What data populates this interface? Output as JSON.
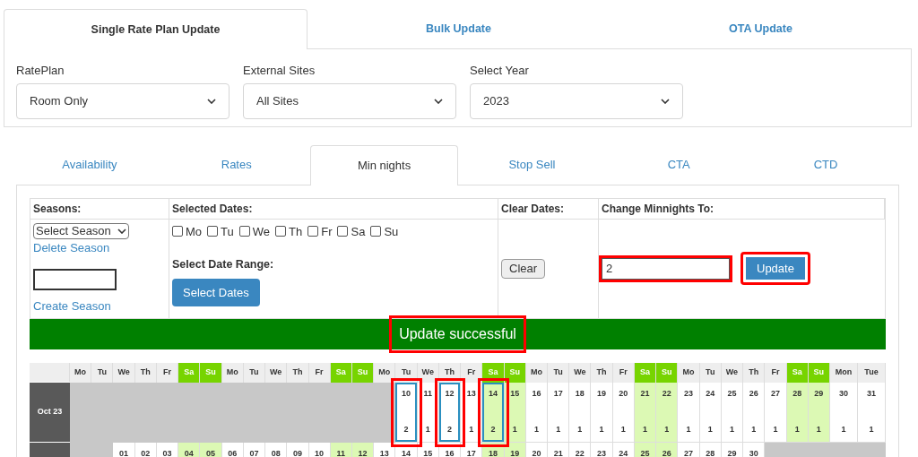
{
  "top_tabs": [
    {
      "label": "Single Rate Plan Update",
      "selected": true
    },
    {
      "label": "Bulk Update",
      "selected": false
    },
    {
      "label": "OTA Update",
      "selected": false
    }
  ],
  "filters": [
    {
      "label": "RatePlan",
      "value": "Room Only"
    },
    {
      "label": "External Sites",
      "value": "All Sites"
    },
    {
      "label": "Select Year",
      "value": "2023"
    }
  ],
  "sub_tabs": [
    {
      "label": "Availability",
      "selected": false
    },
    {
      "label": "Rates",
      "selected": false
    },
    {
      "label": "Min nights",
      "selected": true
    },
    {
      "label": "Stop Sell",
      "selected": false
    },
    {
      "label": "CTA",
      "selected": false
    },
    {
      "label": "CTD",
      "selected": false
    }
  ],
  "form": {
    "headers": [
      "Seasons:",
      "Selected Dates:",
      "Clear Dates:",
      "Change Minnights To:"
    ],
    "season_select": "Select Season",
    "delete_season": "Delete Season",
    "create_season": "Create Season",
    "weekdays": [
      {
        "label": "Mo",
        "checked": false
      },
      {
        "label": "Tu",
        "checked": false
      },
      {
        "label": "We",
        "checked": false
      },
      {
        "label": "Th",
        "checked": false
      },
      {
        "label": "Fr",
        "checked": false
      },
      {
        "label": "Sa",
        "checked": false
      },
      {
        "label": "Su",
        "checked": false
      }
    ],
    "date_range_label": "Select Date Range:",
    "select_dates_button": "Select Dates",
    "clear_button": "Clear",
    "minnights_value": "2",
    "minnights_annotated": true,
    "update_button": "Update",
    "update_annotated": true
  },
  "message": {
    "text": "Update successful",
    "annotated": true
  },
  "calendar": {
    "header": [
      {
        "label": "Mo",
        "weekend": false
      },
      {
        "label": "Tu",
        "weekend": false
      },
      {
        "label": "We",
        "weekend": false
      },
      {
        "label": "Th",
        "weekend": false
      },
      {
        "label": "Fr",
        "weekend": false
      },
      {
        "label": "Sa",
        "weekend": true
      },
      {
        "label": "Su",
        "weekend": true
      },
      {
        "label": "Mo",
        "weekend": false
      },
      {
        "label": "Tu",
        "weekend": false
      },
      {
        "label": "We",
        "weekend": false
      },
      {
        "label": "Th",
        "weekend": false
      },
      {
        "label": "Fr",
        "weekend": false
      },
      {
        "label": "Sa",
        "weekend": true
      },
      {
        "label": "Su",
        "weekend": true
      },
      {
        "label": "Mo",
        "weekend": false
      },
      {
        "label": "Tu",
        "weekend": false
      },
      {
        "label": "We",
        "weekend": false
      },
      {
        "label": "Th",
        "weekend": false
      },
      {
        "label": "Fr",
        "weekend": false
      },
      {
        "label": "Sa",
        "weekend": true
      },
      {
        "label": "Su",
        "weekend": true
      },
      {
        "label": "Mo",
        "weekend": false
      },
      {
        "label": "Tu",
        "weekend": false
      },
      {
        "label": "We",
        "weekend": false
      },
      {
        "label": "Th",
        "weekend": false
      },
      {
        "label": "Fr",
        "weekend": false
      },
      {
        "label": "Sa",
        "weekend": true
      },
      {
        "label": "Su",
        "weekend": true
      },
      {
        "label": "Mo",
        "weekend": false
      },
      {
        "label": "Tu",
        "weekend": false
      },
      {
        "label": "We",
        "weekend": false
      },
      {
        "label": "Th",
        "weekend": false
      },
      {
        "label": "Fr",
        "weekend": false
      },
      {
        "label": "Sa",
        "weekend": true
      },
      {
        "label": "Su",
        "weekend": true
      },
      {
        "label": "Mon",
        "weekend": false
      },
      {
        "label": "Tue",
        "weekend": false
      }
    ],
    "months": [
      {
        "label": "Oct 23",
        "cells": [
          {
            "kind": "blank"
          },
          {
            "kind": "blank"
          },
          {
            "kind": "blank"
          },
          {
            "kind": "blank"
          },
          {
            "kind": "blank"
          },
          {
            "kind": "blank"
          },
          {
            "kind": "blank"
          },
          {
            "kind": "blank"
          },
          {
            "kind": "blank"
          },
          {
            "kind": "blank"
          },
          {
            "kind": "blank"
          },
          {
            "kind": "blank"
          },
          {
            "kind": "blank"
          },
          {
            "kind": "blank"
          },
          {
            "kind": "blank"
          },
          {
            "kind": "day",
            "day": "10",
            "value": "2",
            "selected": true,
            "annotated": true
          },
          {
            "kind": "day",
            "day": "11",
            "value": "1",
            "selected": false,
            "annotated": false
          },
          {
            "kind": "day",
            "day": "12",
            "value": "2",
            "selected": true,
            "annotated": true
          },
          {
            "kind": "day",
            "day": "13",
            "value": "1",
            "selected": false,
            "annotated": false
          },
          {
            "kind": "day",
            "day": "14",
            "value": "2",
            "selected": true,
            "annotated": true
          },
          {
            "kind": "day",
            "day": "15",
            "value": "1",
            "selected": false,
            "annotated": false
          },
          {
            "kind": "day",
            "day": "16",
            "value": "1",
            "selected": false,
            "annotated": false
          },
          {
            "kind": "day",
            "day": "17",
            "value": "1",
            "selected": false,
            "annotated": false
          },
          {
            "kind": "day",
            "day": "18",
            "value": "1",
            "selected": false,
            "annotated": false
          },
          {
            "kind": "day",
            "day": "19",
            "value": "1",
            "selected": false,
            "annotated": false
          },
          {
            "kind": "day",
            "day": "20",
            "value": "1",
            "selected": false,
            "annotated": false
          },
          {
            "kind": "day",
            "day": "21",
            "value": "1",
            "selected": false,
            "annotated": false
          },
          {
            "kind": "day",
            "day": "22",
            "value": "1",
            "selected": false,
            "annotated": false
          },
          {
            "kind": "day",
            "day": "23",
            "value": "1",
            "selected": false,
            "annotated": false
          },
          {
            "kind": "day",
            "day": "24",
            "value": "1",
            "selected": false,
            "annotated": false
          },
          {
            "kind": "day",
            "day": "25",
            "value": "1",
            "selected": false,
            "annotated": false
          },
          {
            "kind": "day",
            "day": "26",
            "value": "1",
            "selected": false,
            "annotated": false
          },
          {
            "kind": "day",
            "day": "27",
            "value": "1",
            "selected": false,
            "annotated": false
          },
          {
            "kind": "day",
            "day": "28",
            "value": "1",
            "selected": false,
            "annotated": false
          },
          {
            "kind": "day",
            "day": "29",
            "value": "1",
            "selected": false,
            "annotated": false
          },
          {
            "kind": "day",
            "day": "30",
            "value": "1",
            "selected": false,
            "annotated": false
          },
          {
            "kind": "day",
            "day": "31",
            "value": "1",
            "selected": false,
            "annotated": false
          }
        ]
      },
      {
        "cells": [
          {
            "kind": "blank"
          },
          {
            "kind": "blank"
          },
          {
            "kind": "day",
            "day": "01"
          },
          {
            "kind": "day",
            "day": "02"
          },
          {
            "kind": "day",
            "day": "03"
          },
          {
            "kind": "day",
            "day": "04"
          },
          {
            "kind": "day",
            "day": "05"
          },
          {
            "kind": "day",
            "day": "06"
          },
          {
            "kind": "day",
            "day": "07"
          },
          {
            "kind": "day",
            "day": "08"
          },
          {
            "kind": "day",
            "day": "09"
          },
          {
            "kind": "day",
            "day": "10"
          },
          {
            "kind": "day",
            "day": "11"
          },
          {
            "kind": "day",
            "day": "12"
          },
          {
            "kind": "day",
            "day": "13"
          },
          {
            "kind": "day",
            "day": "14"
          },
          {
            "kind": "day",
            "day": "15"
          },
          {
            "kind": "day",
            "day": "16"
          },
          {
            "kind": "day",
            "day": "17"
          },
          {
            "kind": "day",
            "day": "18"
          },
          {
            "kind": "day",
            "day": "19"
          },
          {
            "kind": "day",
            "day": "20"
          },
          {
            "kind": "day",
            "day": "21"
          },
          {
            "kind": "day",
            "day": "22"
          },
          {
            "kind": "day",
            "day": "23"
          },
          {
            "kind": "day",
            "day": "24"
          },
          {
            "kind": "day",
            "day": "25"
          },
          {
            "kind": "day",
            "day": "26"
          },
          {
            "kind": "day",
            "day": "27"
          },
          {
            "kind": "day",
            "day": "28"
          },
          {
            "kind": "day",
            "day": "29"
          },
          {
            "kind": "day",
            "day": "30"
          },
          {
            "kind": "blank"
          },
          {
            "kind": "blank"
          },
          {
            "kind": "blank"
          },
          {
            "kind": "blank"
          },
          {
            "kind": "blank"
          }
        ]
      }
    ]
  }
}
